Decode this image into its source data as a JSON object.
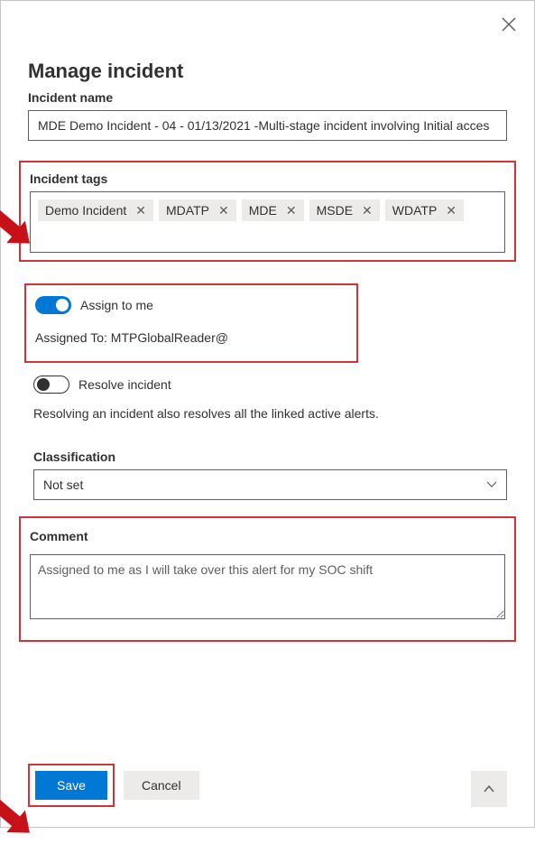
{
  "dialog": {
    "title": "Manage incident",
    "incident_name_label": "Incident name",
    "incident_name_value": "MDE Demo Incident - 04 - 01/13/2021 -Multi-stage incident involving Initial acces",
    "tags_label": "Incident tags",
    "tags": [
      {
        "label": "Demo Incident"
      },
      {
        "label": "MDATP"
      },
      {
        "label": "MDE"
      },
      {
        "label": "MSDE"
      },
      {
        "label": "WDATP"
      }
    ],
    "assign_toggle_label": "Assign to me",
    "assign_toggle_on": true,
    "assigned_to_prefix": "Assigned To: ",
    "assigned_to_value": "MTPGlobalReader@",
    "resolve_toggle_label": "Resolve incident",
    "resolve_toggle_on": false,
    "resolve_note": "Resolving an incident also resolves all the linked active alerts.",
    "classification_label": "Classification",
    "classification_value": "Not set",
    "comment_label": "Comment",
    "comment_value": "Assigned to me as I will take over this alert for my SOC shift",
    "save_label": "Save",
    "cancel_label": "Cancel"
  },
  "colors": {
    "primary": "#0078d4",
    "highlight_border": "#d13438",
    "arrow": "#c81018"
  }
}
